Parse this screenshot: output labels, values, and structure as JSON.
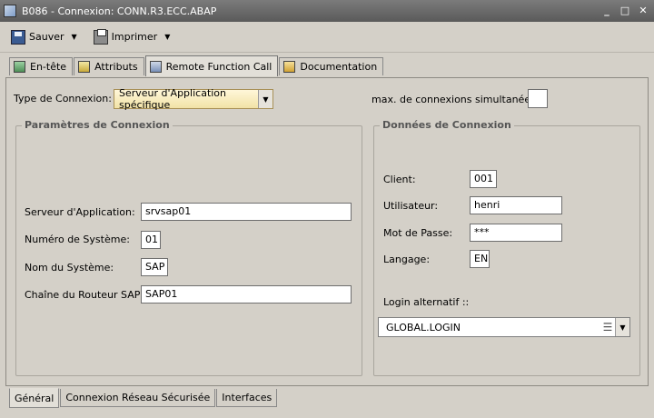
{
  "window": {
    "title": "B086 - Connexion: CONN.R3.ECC.ABAP",
    "min": "_",
    "max": "□",
    "close": "✕"
  },
  "toolbar": {
    "save_label": "Sauver",
    "print_label": "Imprimer"
  },
  "tabs": [
    "En-tête",
    "Attributs",
    "Remote Function Call",
    "Documentation"
  ],
  "connection": {
    "type_label": "Type de Connexion:",
    "type_value": "Serveur d'Application spécifique",
    "max_label": "max. de connexions simultanées:",
    "max_value": ""
  },
  "params": {
    "title": "Paramètres de Connexion",
    "server_label": "Serveur d'Application:",
    "server_value": "srvsap01",
    "sysnum_label": "Numéro de Système:",
    "sysnum_value": "01",
    "sysname_label": "Nom du Système:",
    "sysname_value": "SAP",
    "router_label": "Chaîne du Routeur SAP:",
    "router_value": "SAP01"
  },
  "data": {
    "title": "Données de Connexion",
    "client_label": "Client:",
    "client_value": "001",
    "user_label": "Utilisateur:",
    "user_value": "henri",
    "pass_label": "Mot de Passe:",
    "pass_value": "***",
    "lang_label": "Langage:",
    "lang_value": "EN",
    "alt_label": "Login alternatif ::",
    "alt_value": "GLOBAL.LOGIN"
  },
  "bottom_tabs": [
    "Général",
    "Connexion Réseau Sécurisée",
    "Interfaces"
  ]
}
